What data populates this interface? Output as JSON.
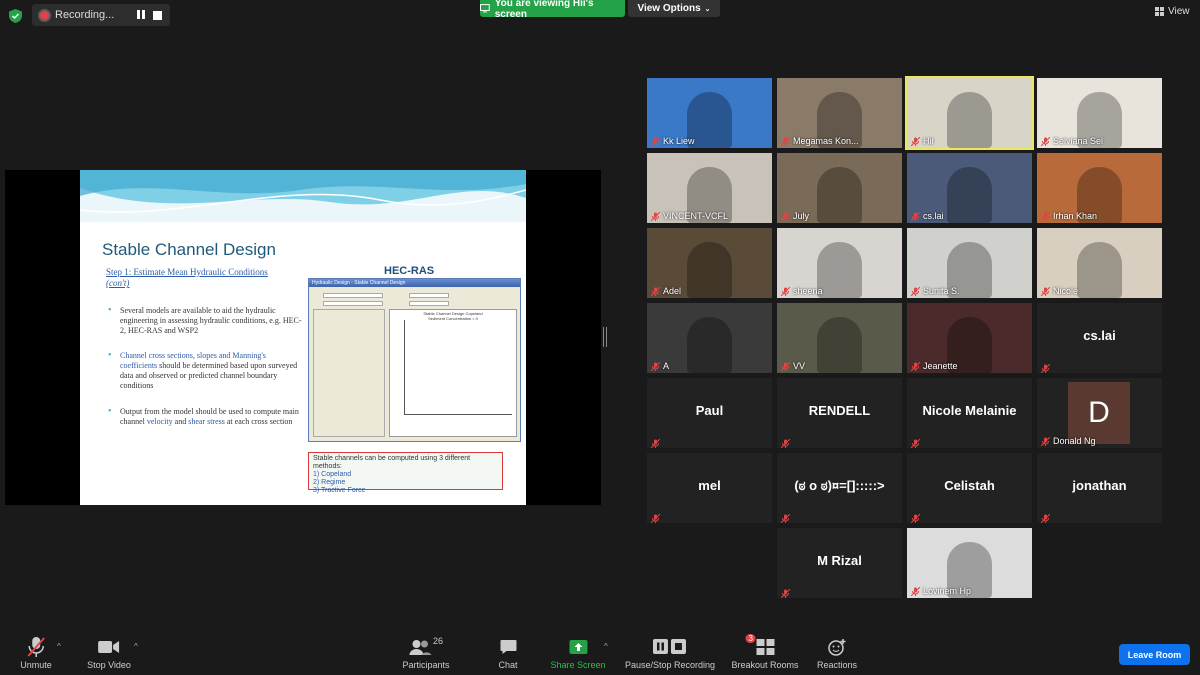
{
  "topbar": {
    "recording_label": "Recording...",
    "viewing_label": "You are viewing Hii's screen",
    "view_options_label": "View Options",
    "view_label": "View"
  },
  "slide": {
    "title": "Stable Channel Design",
    "step_line1": "Step 1: Estimate Mean Hydraulic Conditions",
    "step_line2": "(con't)",
    "hecras": "HEC-RAS",
    "bullet1": "Several models are available to aid the hydraulic engineering in assessing hydraulic conditions, e.g. HEC-2, HEC-RAS and WSP2",
    "bullet2_blue": "Channel cross sections, slopes and Manning's coefficients",
    "bullet2_rest": " should be determined based upon surveyed data and observed or predicted channel boundary conditions",
    "bullet3_a": "Output from the model should be used to compute main channel ",
    "bullet3_b": "velocity",
    "bullet3_c": " and ",
    "bullet3_d": "shear stress",
    "bullet3_e": " at each cross section",
    "box_head": "Stable channels can be computed using 3 different methods:",
    "box_items": [
      "1)    Copeland",
      "2)    Regime",
      "3)    Tractive Force"
    ],
    "window_title": "Hydraulic Design - Stable Channel Design",
    "plot_title": "Stable Channel Design Copeland",
    "plot_sub": "Sediment Concentration = 0"
  },
  "participants": [
    {
      "name": "Kk Liew",
      "color": "#3a78c8"
    },
    {
      "name": "Megamas Kon...",
      "color": "#8a7a68"
    },
    {
      "name": "Hii",
      "color": "#d8d4c8"
    },
    {
      "name": "Selviana Sel",
      "color": "#e8e4dc"
    },
    {
      "name": "VINCENT-VCFL",
      "color": "#c9c2b8"
    },
    {
      "name": "July",
      "color": "#7a6a58"
    },
    {
      "name": "cs.lai",
      "color": "#4a5a78"
    },
    {
      "name": "Irhan Khan",
      "color": "#b86a3a"
    },
    {
      "name": "Adel",
      "color": "#5a4a38"
    },
    {
      "name": "sheena",
      "color": "#d8d4d0"
    },
    {
      "name": "Sunita S.",
      "color": "#d0d0cc"
    },
    {
      "name": "Nicole",
      "color": "#d8cfc0"
    },
    {
      "name": "A",
      "color": "#3a3a3a"
    },
    {
      "name": "VV",
      "color": "#5a5a4a"
    },
    {
      "name": "Jeanette",
      "color": "#4a2a2a"
    },
    {
      "name": "cs.lai",
      "color": ""
    },
    {
      "name": "Paul",
      "color": ""
    },
    {
      "name": "RENDELL",
      "color": ""
    },
    {
      "name": "Nicole Melainie",
      "color": ""
    },
    {
      "name": "Donald Ng",
      "color": ""
    },
    {
      "name": "mel",
      "color": ""
    },
    {
      "name": "(ಠ o ಠ)¤=[]:::::>",
      "color": ""
    },
    {
      "name": "Celistah",
      "color": ""
    },
    {
      "name": "jonathan",
      "color": ""
    },
    {
      "name": "M Rizal",
      "color": ""
    },
    {
      "name": "Lovinem Hp",
      "color": "#dcdcdc"
    }
  ],
  "donald_initial": "D",
  "toolbar": {
    "unmute": "Unmute",
    "stop_video": "Stop Video",
    "participants": "Participants",
    "participants_count": "26",
    "chat": "Chat",
    "share_screen": "Share Screen",
    "pause_recording": "Pause/Stop Recording",
    "breakout": "Breakout Rooms",
    "breakout_badge": "3",
    "reactions": "Reactions",
    "leave": "Leave Room"
  },
  "colors": {
    "accent": "#0e72ed",
    "green": "#24a248",
    "muted_red": "#e04444"
  }
}
